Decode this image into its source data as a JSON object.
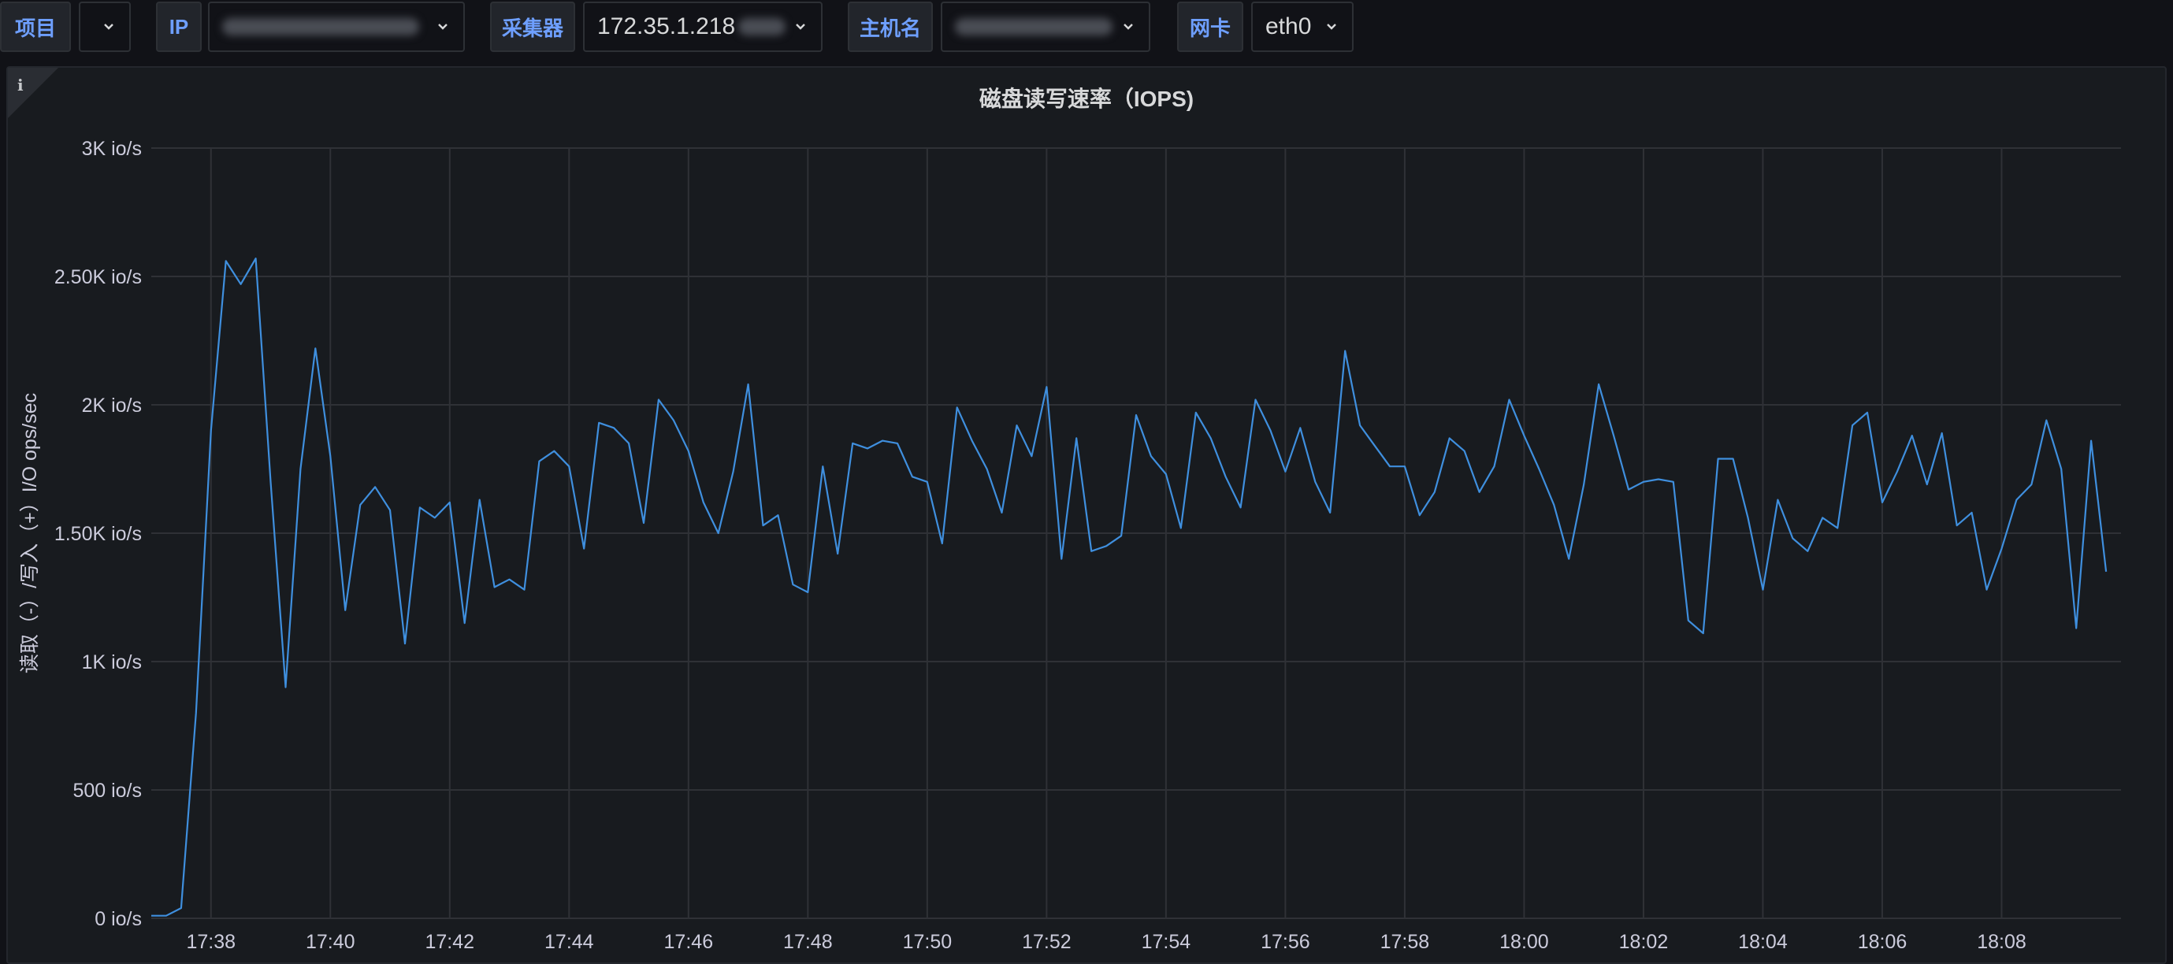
{
  "toolbar": {
    "project_label": "项目",
    "ip_label": "IP",
    "collector_label": "采集器",
    "collector_value": "172.35.1.218",
    "hostname_label": "主机名",
    "nic_label": "网卡",
    "nic_value": "eth0"
  },
  "panel": {
    "info_icon": "info-icon",
    "title": "磁盘读写速率（IOPS)"
  },
  "colors": {
    "series": "#3f8fde",
    "grid": "#2f3136",
    "accent_label": "#6e9fff"
  },
  "chart_data": {
    "type": "line",
    "title": "磁盘读写速率（IOPS)",
    "ylabel": "读取（-）/写入（+）I/O ops/sec",
    "xlabel": "",
    "ylim": [
      0,
      3000
    ],
    "y_ticks": [
      0,
      500,
      1000,
      1500,
      2000,
      2500,
      3000
    ],
    "y_tick_labels": [
      "0 io/s",
      "500 io/s",
      "1K io/s",
      "1.50K io/s",
      "2K io/s",
      "2.50K io/s",
      "3K io/s"
    ],
    "x_range": [
      "17:37:00",
      "18:10:00"
    ],
    "x_ticks": [
      "17:38",
      "17:40",
      "17:42",
      "17:44",
      "17:46",
      "17:48",
      "17:50",
      "17:52",
      "17:54",
      "17:56",
      "17:58",
      "18:00",
      "18:02",
      "18:04",
      "18:06",
      "18:08"
    ],
    "grid": true,
    "series": [
      {
        "x": [
          "17:37:00",
          "17:37:15",
          "17:37:30",
          "17:37:45",
          "17:38:00",
          "17:38:15",
          "17:38:30",
          "17:38:45",
          "17:39:00",
          "17:39:15",
          "17:39:30",
          "17:39:45",
          "17:40:00",
          "17:40:15",
          "17:40:30",
          "17:40:45",
          "17:41:00",
          "17:41:15",
          "17:41:30",
          "17:41:45",
          "17:42:00",
          "17:42:15",
          "17:42:30",
          "17:42:45",
          "17:43:00",
          "17:43:15",
          "17:43:30",
          "17:43:45",
          "17:44:00",
          "17:44:15",
          "17:44:30",
          "17:44:45",
          "17:45:00",
          "17:45:15",
          "17:45:30",
          "17:45:45",
          "17:46:00",
          "17:46:15",
          "17:46:30",
          "17:46:45",
          "17:47:00",
          "17:47:15",
          "17:47:30",
          "17:47:45",
          "17:48:00",
          "17:48:15",
          "17:48:30",
          "17:48:45",
          "17:49:00",
          "17:49:15",
          "17:49:30",
          "17:49:45",
          "17:50:00",
          "17:50:15",
          "17:50:30",
          "17:50:45",
          "17:51:00",
          "17:51:15",
          "17:51:30",
          "17:51:45",
          "17:52:00",
          "17:52:15",
          "17:52:30",
          "17:52:45",
          "17:53:00",
          "17:53:15",
          "17:53:30",
          "17:53:45",
          "17:54:00",
          "17:54:15",
          "17:54:30",
          "17:54:45",
          "17:55:00",
          "17:55:15",
          "17:55:30",
          "17:55:45",
          "17:56:00",
          "17:56:15",
          "17:56:30",
          "17:56:45",
          "17:57:00",
          "17:57:15",
          "17:57:30",
          "17:57:45",
          "17:58:00",
          "17:58:15",
          "17:58:30",
          "17:58:45",
          "17:59:00",
          "17:59:15",
          "17:59:30",
          "17:59:45",
          "18:00:00",
          "18:00:15",
          "18:00:30",
          "18:00:45",
          "18:01:00",
          "18:01:15",
          "18:01:30",
          "18:01:45",
          "18:02:00",
          "18:02:15",
          "18:02:30",
          "18:02:45",
          "18:03:00",
          "18:03:15",
          "18:03:30",
          "18:03:45",
          "18:04:00",
          "18:04:15",
          "18:04:30",
          "18:04:45",
          "18:05:00",
          "18:05:15",
          "18:05:30",
          "18:05:45",
          "18:06:00",
          "18:06:15",
          "18:06:30",
          "18:06:45",
          "18:07:00",
          "18:07:15",
          "18:07:30",
          "18:07:45",
          "18:08:00",
          "18:08:15",
          "18:08:30",
          "18:08:45",
          "18:09:00",
          "18:09:15",
          "18:09:30",
          "18:09:45"
        ],
        "values": [
          10,
          10,
          40,
          800,
          1900,
          2560,
          2470,
          2570,
          1700,
          900,
          1750,
          2220,
          1800,
          1200,
          1610,
          1680,
          1590,
          1070,
          1600,
          1560,
          1620,
          1150,
          1630,
          1290,
          1320,
          1280,
          1780,
          1820,
          1760,
          1440,
          1930,
          1910,
          1850,
          1540,
          2020,
          1940,
          1820,
          1620,
          1500,
          1740,
          2080,
          1530,
          1570,
          1300,
          1270,
          1760,
          1420,
          1850,
          1830,
          1860,
          1850,
          1720,
          1700,
          1460,
          1990,
          1860,
          1750,
          1580,
          1920,
          1800,
          2070,
          1400,
          1870,
          1430,
          1450,
          1490,
          1960,
          1800,
          1730,
          1520,
          1970,
          1870,
          1720,
          1600,
          2020,
          1900,
          1740,
          1910,
          1700,
          1580,
          2210,
          1920,
          1840,
          1760,
          1760,
          1570,
          1660,
          1870,
          1820,
          1660,
          1760,
          2020,
          1880,
          1750,
          1610,
          1400,
          1690,
          2080,
          1880,
          1670,
          1700,
          1710,
          1700,
          1160,
          1110,
          1790,
          1790,
          1560,
          1280,
          1630,
          1480,
          1430,
          1560,
          1520,
          1920,
          1970,
          1620,
          1740,
          1880,
          1690,
          1890,
          1530,
          1580,
          1280,
          1440,
          1630,
          1690,
          1940,
          1750,
          1130,
          1860,
          1350
        ]
      }
    ]
  }
}
